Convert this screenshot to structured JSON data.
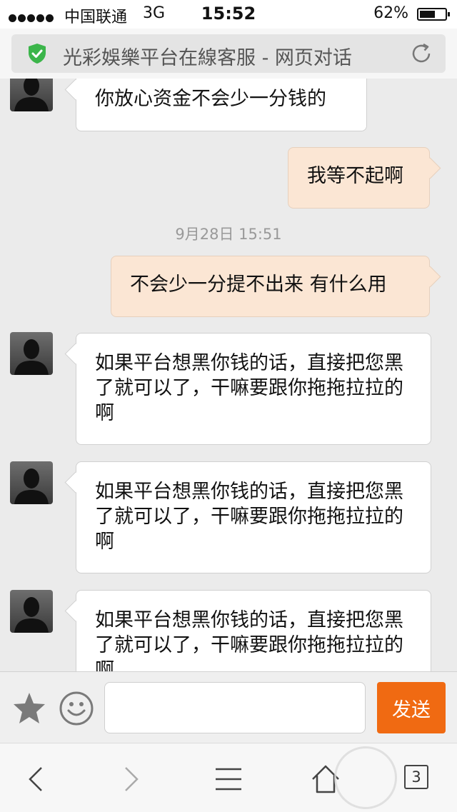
{
  "status_bar": {
    "carrier": "中国联通",
    "network": "3G",
    "time": "15:52",
    "battery_percent": "62%",
    "battery_level": 0.62
  },
  "address_bar": {
    "title": "光彩娛樂平台在線客服 - 网页对话",
    "secure_icon": "shield-check-icon",
    "reload_icon": "refresh-icon",
    "accent_color": "#3bb54a"
  },
  "messages": [
    {
      "side": "in",
      "text": "你放心资金不会少一分钱的"
    },
    {
      "side": "out",
      "text": "我等不起啊"
    },
    {
      "type": "timestamp",
      "text": "9月28日 15:51"
    },
    {
      "side": "out",
      "text": "不会少一分提不出来 有什么用"
    },
    {
      "side": "in",
      "text": "如果平台想黑你钱的话，直接把您黑了就可以了，干嘛要跟你拖拖拉拉的啊"
    },
    {
      "side": "in",
      "text": "如果平台想黑你钱的话，直接把您黑了就可以了，干嘛要跟你拖拖拉拉的啊"
    },
    {
      "side": "in",
      "text": "如果平台想黑你钱的话，直接把您黑了就可以了，干嘛要跟你拖拖拉拉的啊"
    }
  ],
  "composer": {
    "favorite_icon": "star-icon",
    "emoji_icon": "smiley-icon",
    "input_value": "",
    "send_label": "发送",
    "send_color": "#f06a12"
  },
  "toolbar": {
    "icons": [
      "back-icon",
      "forward-icon",
      "menu-icon",
      "home-icon"
    ],
    "tab_count": "3"
  }
}
